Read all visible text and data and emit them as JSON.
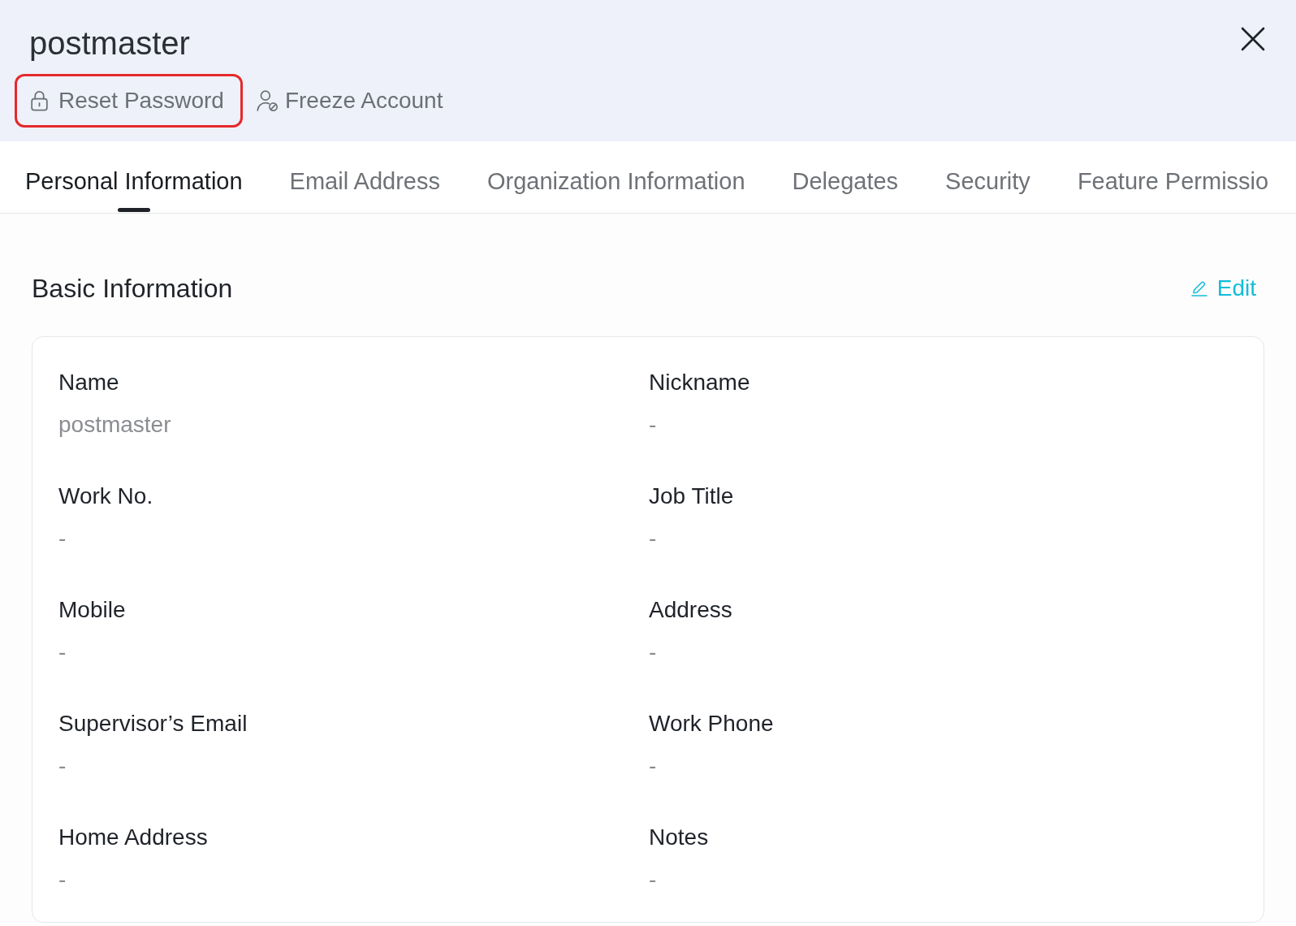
{
  "header": {
    "title": "postmaster"
  },
  "actions": [
    {
      "kind": "reset",
      "label": "Reset Password",
      "highlighted": true
    },
    {
      "kind": "freeze",
      "label": "Freeze Account",
      "highlighted": false
    }
  ],
  "tabs": [
    {
      "label": "Personal Information",
      "selected": true
    },
    {
      "label": "Email Address",
      "selected": false
    },
    {
      "label": "Organization Information",
      "selected": false
    },
    {
      "label": "Delegates",
      "selected": false
    },
    {
      "label": "Security",
      "selected": false
    },
    {
      "label": "Feature Permissio",
      "selected": false
    }
  ],
  "section": {
    "title": "Basic Information",
    "edit_label": "Edit"
  },
  "fields": [
    {
      "label": "Name",
      "value": "postmaster"
    },
    {
      "label": "Nickname",
      "value": "-"
    },
    {
      "label": "Work No.",
      "value": "-"
    },
    {
      "label": "Job Title",
      "value": "-"
    },
    {
      "label": "Mobile",
      "value": "-"
    },
    {
      "label": "Address",
      "value": "-"
    },
    {
      "label": "Supervisor’s Email",
      "value": "-"
    },
    {
      "label": "Work Phone",
      "value": "-"
    },
    {
      "label": "Home Address",
      "value": "-"
    },
    {
      "label": "Notes",
      "value": "-"
    }
  ]
}
